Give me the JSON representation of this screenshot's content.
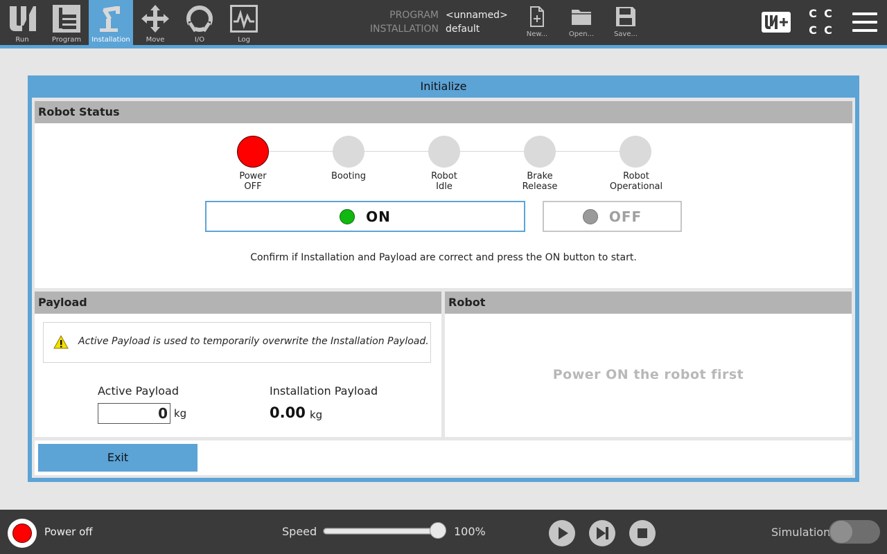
{
  "tabs": [
    {
      "label": "Run",
      "icon": "ur-logo-icon",
      "active": false
    },
    {
      "label": "Program",
      "icon": "program-tree-icon",
      "active": false
    },
    {
      "label": "Installation",
      "icon": "robot-arm-icon",
      "active": true
    },
    {
      "label": "Move",
      "icon": "move-arrows-icon",
      "active": false
    },
    {
      "label": "I/O",
      "icon": "io-icon",
      "active": false
    },
    {
      "label": "Log",
      "icon": "log-chart-icon",
      "active": false
    }
  ],
  "program_info": {
    "program_key": "PROGRAM",
    "program_value": "<unnamed>",
    "installation_key": "INSTALLATION",
    "installation_value": "default"
  },
  "file_buttons": {
    "new_label": "New...",
    "open_label": "Open...",
    "save_label": "Save..."
  },
  "header_right": {
    "cc_letters": [
      "C",
      "C",
      "C",
      "C"
    ]
  },
  "dialog": {
    "title": "Initialize",
    "robot_status": {
      "header": "Robot Status",
      "steps": [
        {
          "line1": "Power",
          "line2": "OFF",
          "state": "current"
        },
        {
          "line1": "Booting",
          "line2": "",
          "state": "pending"
        },
        {
          "line1": "Robot",
          "line2": "Idle",
          "state": "pending"
        },
        {
          "line1": "Brake",
          "line2": "Release",
          "state": "pending"
        },
        {
          "line1": "Robot",
          "line2": "Operational",
          "state": "pending"
        }
      ],
      "on_label": "ON",
      "off_label": "OFF",
      "confirm_text": "Confirm if Installation and Payload are correct and press the ON button to start."
    },
    "payload": {
      "header": "Payload",
      "note": "Active Payload is used to temporarily overwrite the Installation Payload.",
      "active_label": "Active Payload",
      "active_value": "0",
      "active_unit": "kg",
      "installation_label": "Installation Payload",
      "installation_value": "0.00",
      "installation_unit": "kg"
    },
    "robot": {
      "header": "Robot",
      "message": "Power ON the robot first"
    },
    "exit_label": "Exit"
  },
  "footer": {
    "power_status": "Power off",
    "speed_label": "Speed",
    "speed_percent": 100,
    "speed_value": "100%",
    "simulation_label": "Simulation",
    "simulation_on": false
  },
  "colors": {
    "accent": "#5ca3d6",
    "status_off_red": "#ff0000",
    "on_green": "#11b80f",
    "off_grey": "#9a9a9a"
  }
}
